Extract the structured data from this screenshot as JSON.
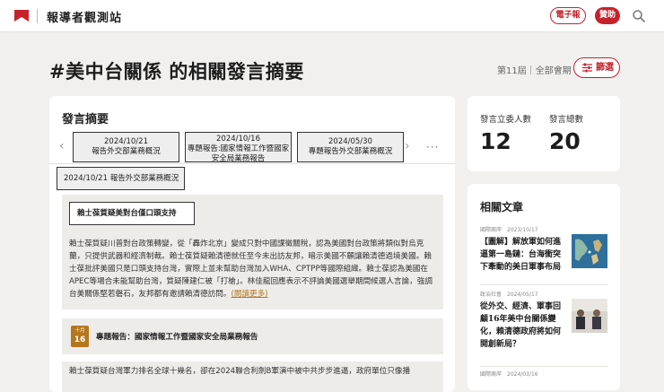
{
  "header": {
    "site_title": "報導者觀測站",
    "epaper_label": "電子報",
    "donate_label": "贊助",
    "brand_color": "#c6222b",
    "icons": [
      "flag-logo-icon",
      "search-icon"
    ]
  },
  "page": {
    "title": "#美中台關係 的相關發言摘要",
    "session": "第11屆",
    "session_sep": "｜",
    "session_scope": "全部會期",
    "filter_label": "篩選"
  },
  "statements": {
    "section_title": "發言摘要",
    "tabs": [
      {
        "date": "2024/10/21",
        "title": "報告外交部業務概況"
      },
      {
        "date": "2024/10/16",
        "title": "專題報告:國家情報工作暨國家安全局業務報告"
      },
      {
        "date": "2024/05/30",
        "title": "專題報告外交部業務概況"
      }
    ],
    "more_icon": "···",
    "active_label": "2024/10/21 報告外交部業務概況",
    "entry1": {
      "heading": "賴士葆質疑美對台僅口頭支持",
      "body": "賴士葆質疑川普對台政策轉變，從「轟炸北京」變成只對中國課徵關稅，認為美國對台政策將類似對烏克蘭，只提供武器和經濟制裁。賴士葆質疑賴清德就任至今未出訪友邦，暗示美國不願讓賴清德過境美國。賴士葆批評美國只是口頭支持台灣，實際上並未幫助台灣加入WHA、CPTPP等國際組織。賴士葆認為美國在APEC等場合未能幫助台灣，質疑陳建仁被「打槍」。林佳龍回應表示不評論美國選舉期間候選人言論，強調台美關係堅若磐石，友邦都有邀請賴清德訪問。",
      "more": "(閱讀更多)"
    },
    "entry2": {
      "month": "十月",
      "day": "16",
      "title": "專題報告：國家情報工作暨國家安全局業務報告"
    },
    "entry3": {
      "body": "賴士葆質疑台灣軍力排名全球十幾名，卻在2024聯合利劍B軍演中被中共步步進逼，政府單位只像播"
    }
  },
  "stats": {
    "legislators_label": "發言立委人數",
    "legislators_value": "12",
    "statements_label": "發言總數",
    "statements_value": "20"
  },
  "related": {
    "title": "相關文章",
    "items": [
      {
        "category": "國際兩岸",
        "date": "2023/10/17",
        "headline": "【圖解】解放軍如何進逼第一島鏈：台海衝突下牽動的美日軍事布局",
        "thumb": "map-thumbnail-icon"
      },
      {
        "category": "政治社會",
        "date": "2024/05/17",
        "headline": "從外交、經濟、軍事回顧16年美中台關係變化，賴清德政府將如何開創新局？",
        "thumb": "photo-thumbnail-icon"
      },
      {
        "category": "國際兩岸",
        "date": "2024/03/16",
        "headline": "",
        "thumb": ""
      }
    ]
  }
}
